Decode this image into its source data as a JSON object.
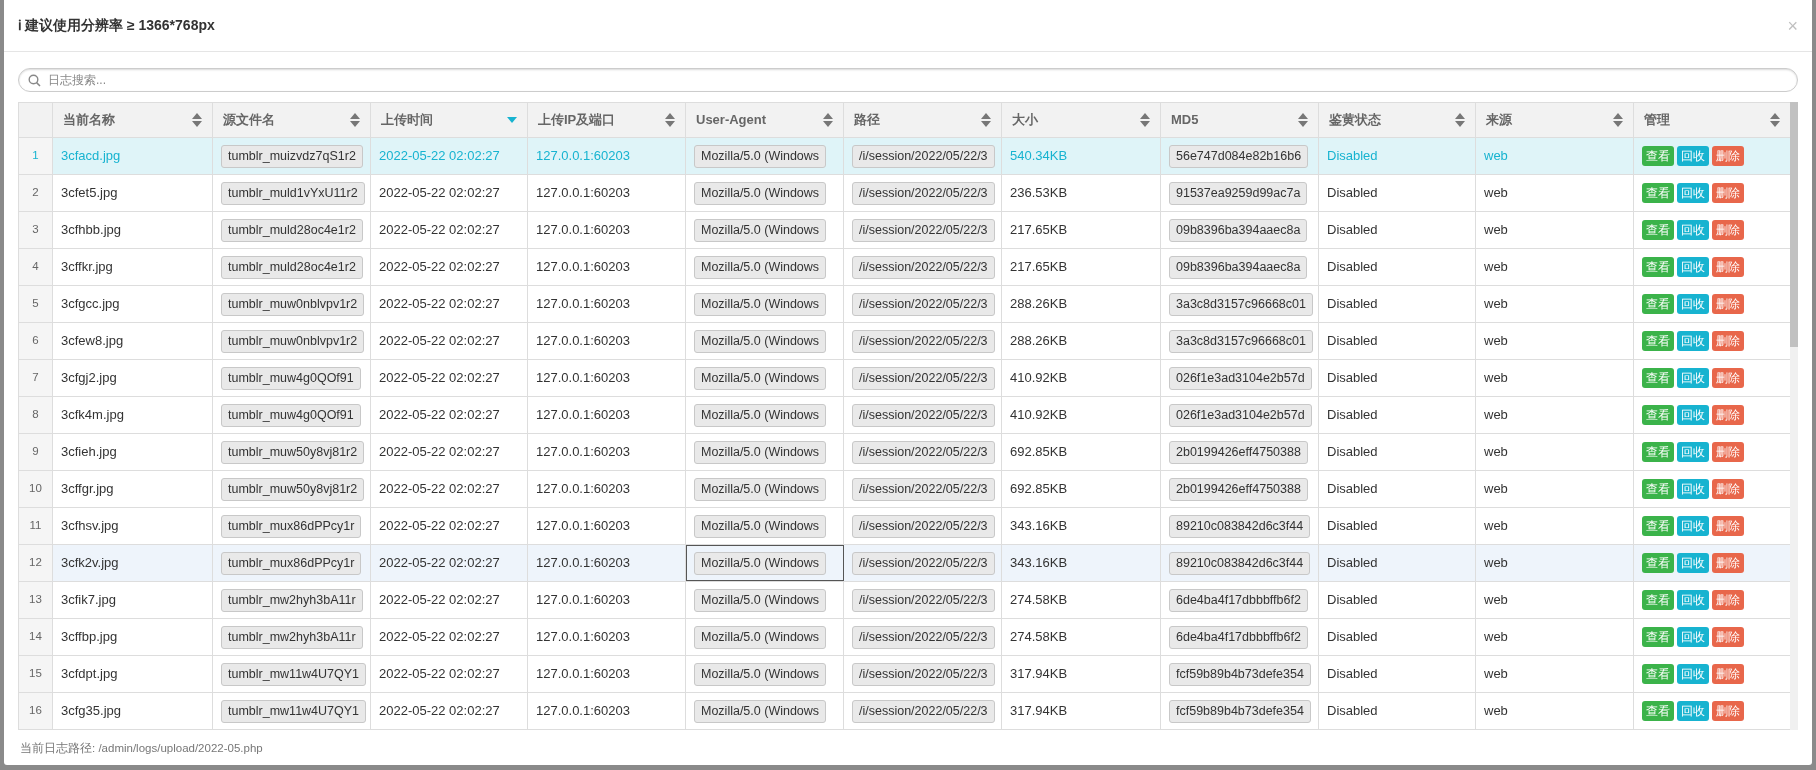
{
  "dialog": {
    "title": "建议使用分辨率 ≥ 1366*768px",
    "info_icon": "ℹ",
    "close": "×"
  },
  "search": {
    "placeholder": "日志搜索..."
  },
  "table": {
    "columns": [
      {
        "label": "当前名称",
        "sorted": false
      },
      {
        "label": "源文件名",
        "sorted": false
      },
      {
        "label": "上传时间",
        "sorted": true
      },
      {
        "label": "上传IP及端口",
        "sorted": false
      },
      {
        "label": "User-Agent",
        "sorted": false
      },
      {
        "label": "路径",
        "sorted": false
      },
      {
        "label": "大小",
        "sorted": false
      },
      {
        "label": "MD5",
        "sorted": false
      },
      {
        "label": "鉴黄状态",
        "sorted": false
      },
      {
        "label": "来源",
        "sorted": false
      },
      {
        "label": "管理",
        "sorted": false
      }
    ],
    "rows": [
      {
        "index": "1",
        "selected": true,
        "hovered": false,
        "name": "3cfacd.jpg",
        "source_file": "tumblr_muizvdz7qS1r2",
        "time": "2022-05-22 02:02:27",
        "ip": "127.0.0.1:60203",
        "user_agent": "Mozilla/5.0 (Windows",
        "path": "/i/session/2022/05/22/3",
        "size": "540.34KB",
        "md5": "56e747d084e82b16b6",
        "status": "Disabled",
        "origin": "web",
        "actions": [
          {
            "label": "查看",
            "kind": "view"
          },
          {
            "label": "回收",
            "kind": "recycle"
          },
          {
            "label": "删除",
            "kind": "delete"
          }
        ]
      },
      {
        "index": "2",
        "selected": false,
        "hovered": false,
        "name": "3cfet5.jpg",
        "source_file": "tumblr_muld1vYxU11r2",
        "time": "2022-05-22 02:02:27",
        "ip": "127.0.0.1:60203",
        "user_agent": "Mozilla/5.0 (Windows",
        "path": "/i/session/2022/05/22/3",
        "size": "236.53KB",
        "md5": "91537ea9259d99ac7a",
        "status": "Disabled",
        "origin": "web",
        "actions": [
          {
            "label": "查看",
            "kind": "view"
          },
          {
            "label": "回收",
            "kind": "recycle"
          },
          {
            "label": "删除",
            "kind": "delete"
          }
        ]
      },
      {
        "index": "3",
        "selected": false,
        "hovered": false,
        "name": "3cfhbb.jpg",
        "source_file": "tumblr_muld28oc4e1r2",
        "time": "2022-05-22 02:02:27",
        "ip": "127.0.0.1:60203",
        "user_agent": "Mozilla/5.0 (Windows",
        "path": "/i/session/2022/05/22/3",
        "size": "217.65KB",
        "md5": "09b8396ba394aaec8a",
        "status": "Disabled",
        "origin": "web",
        "actions": [
          {
            "label": "查看",
            "kind": "view"
          },
          {
            "label": "回收",
            "kind": "recycle"
          },
          {
            "label": "删除",
            "kind": "delete"
          }
        ]
      },
      {
        "index": "4",
        "selected": false,
        "hovered": false,
        "name": "3cffkr.jpg",
        "source_file": "tumblr_muld28oc4e1r2",
        "time": "2022-05-22 02:02:27",
        "ip": "127.0.0.1:60203",
        "user_agent": "Mozilla/5.0 (Windows",
        "path": "/i/session/2022/05/22/3",
        "size": "217.65KB",
        "md5": "09b8396ba394aaec8a",
        "status": "Disabled",
        "origin": "web",
        "actions": [
          {
            "label": "查看",
            "kind": "view"
          },
          {
            "label": "回收",
            "kind": "recycle"
          },
          {
            "label": "删除",
            "kind": "delete"
          }
        ]
      },
      {
        "index": "5",
        "selected": false,
        "hovered": false,
        "name": "3cfgcc.jpg",
        "source_file": "tumblr_muw0nblvpv1r2",
        "time": "2022-05-22 02:02:27",
        "ip": "127.0.0.1:60203",
        "user_agent": "Mozilla/5.0 (Windows",
        "path": "/i/session/2022/05/22/3",
        "size": "288.26KB",
        "md5": "3a3c8d3157c96668c01",
        "status": "Disabled",
        "origin": "web",
        "actions": [
          {
            "label": "查看",
            "kind": "view"
          },
          {
            "label": "回收",
            "kind": "recycle"
          },
          {
            "label": "删除",
            "kind": "delete"
          }
        ]
      },
      {
        "index": "6",
        "selected": false,
        "hovered": false,
        "name": "3cfew8.jpg",
        "source_file": "tumblr_muw0nblvpv1r2",
        "time": "2022-05-22 02:02:27",
        "ip": "127.0.0.1:60203",
        "user_agent": "Mozilla/5.0 (Windows",
        "path": "/i/session/2022/05/22/3",
        "size": "288.26KB",
        "md5": "3a3c8d3157c96668c01",
        "status": "Disabled",
        "origin": "web",
        "actions": [
          {
            "label": "查看",
            "kind": "view"
          },
          {
            "label": "回收",
            "kind": "recycle"
          },
          {
            "label": "删除",
            "kind": "delete"
          }
        ]
      },
      {
        "index": "7",
        "selected": false,
        "hovered": false,
        "name": "3cfgj2.jpg",
        "source_file": "tumblr_muw4g0QOf91",
        "time": "2022-05-22 02:02:27",
        "ip": "127.0.0.1:60203",
        "user_agent": "Mozilla/5.0 (Windows",
        "path": "/i/session/2022/05/22/3",
        "size": "410.92KB",
        "md5": "026f1e3ad3104e2b57d",
        "status": "Disabled",
        "origin": "web",
        "actions": [
          {
            "label": "查看",
            "kind": "view"
          },
          {
            "label": "回收",
            "kind": "recycle"
          },
          {
            "label": "删除",
            "kind": "delete"
          }
        ]
      },
      {
        "index": "8",
        "selected": false,
        "hovered": false,
        "name": "3cfk4m.jpg",
        "source_file": "tumblr_muw4g0QOf91",
        "time": "2022-05-22 02:02:27",
        "ip": "127.0.0.1:60203",
        "user_agent": "Mozilla/5.0 (Windows",
        "path": "/i/session/2022/05/22/3",
        "size": "410.92KB",
        "md5": "026f1e3ad3104e2b57d",
        "status": "Disabled",
        "origin": "web",
        "actions": [
          {
            "label": "查看",
            "kind": "view"
          },
          {
            "label": "回收",
            "kind": "recycle"
          },
          {
            "label": "删除",
            "kind": "delete"
          }
        ]
      },
      {
        "index": "9",
        "selected": false,
        "hovered": false,
        "name": "3cfieh.jpg",
        "source_file": "tumblr_muw50y8vj81r2",
        "time": "2022-05-22 02:02:27",
        "ip": "127.0.0.1:60203",
        "user_agent": "Mozilla/5.0 (Windows",
        "path": "/i/session/2022/05/22/3",
        "size": "692.85KB",
        "md5": "2b0199426eff4750388",
        "status": "Disabled",
        "origin": "web",
        "actions": [
          {
            "label": "查看",
            "kind": "view"
          },
          {
            "label": "回收",
            "kind": "recycle"
          },
          {
            "label": "删除",
            "kind": "delete"
          }
        ]
      },
      {
        "index": "10",
        "selected": false,
        "hovered": false,
        "name": "3cffgr.jpg",
        "source_file": "tumblr_muw50y8vj81r2",
        "time": "2022-05-22 02:02:27",
        "ip": "127.0.0.1:60203",
        "user_agent": "Mozilla/5.0 (Windows",
        "path": "/i/session/2022/05/22/3",
        "size": "692.85KB",
        "md5": "2b0199426eff4750388",
        "status": "Disabled",
        "origin": "web",
        "actions": [
          {
            "label": "查看",
            "kind": "view"
          },
          {
            "label": "回收",
            "kind": "recycle"
          },
          {
            "label": "删除",
            "kind": "delete"
          }
        ]
      },
      {
        "index": "11",
        "selected": false,
        "hovered": false,
        "name": "3cfhsv.jpg",
        "source_file": "tumblr_mux86dPPcy1r",
        "time": "2022-05-22 02:02:27",
        "ip": "127.0.0.1:60203",
        "user_agent": "Mozilla/5.0 (Windows",
        "path": "/i/session/2022/05/22/3",
        "size": "343.16KB",
        "md5": "89210c083842d6c3f44",
        "status": "Disabled",
        "origin": "web",
        "actions": [
          {
            "label": "查看",
            "kind": "view"
          },
          {
            "label": "回收",
            "kind": "recycle"
          },
          {
            "label": "删除",
            "kind": "delete"
          }
        ]
      },
      {
        "index": "12",
        "selected": false,
        "hovered": true,
        "name": "3cfk2v.jpg",
        "source_file": "tumblr_mux86dPPcy1r",
        "time": "2022-05-22 02:02:27",
        "ip": "127.0.0.1:60203",
        "user_agent": "Mozilla/5.0 (Windows",
        "path": "/i/session/2022/05/22/3",
        "size": "343.16KB",
        "md5": "89210c083842d6c3f44",
        "status": "Disabled",
        "origin": "web",
        "actions": [
          {
            "label": "查看",
            "kind": "view"
          },
          {
            "label": "回收",
            "kind": "recycle"
          },
          {
            "label": "删除",
            "kind": "delete"
          }
        ]
      },
      {
        "index": "13",
        "selected": false,
        "hovered": false,
        "name": "3cfik7.jpg",
        "source_file": "tumblr_mw2hyh3bA11r",
        "time": "2022-05-22 02:02:27",
        "ip": "127.0.0.1:60203",
        "user_agent": "Mozilla/5.0 (Windows",
        "path": "/i/session/2022/05/22/3",
        "size": "274.58KB",
        "md5": "6de4ba4f17dbbbffb6f2",
        "status": "Disabled",
        "origin": "web",
        "actions": [
          {
            "label": "查看",
            "kind": "view"
          },
          {
            "label": "回收",
            "kind": "recycle"
          },
          {
            "label": "删除",
            "kind": "delete"
          }
        ]
      },
      {
        "index": "14",
        "selected": false,
        "hovered": false,
        "name": "3cffbp.jpg",
        "source_file": "tumblr_mw2hyh3bA11r",
        "time": "2022-05-22 02:02:27",
        "ip": "127.0.0.1:60203",
        "user_agent": "Mozilla/5.0 (Windows",
        "path": "/i/session/2022/05/22/3",
        "size": "274.58KB",
        "md5": "6de4ba4f17dbbbffb6f2",
        "status": "Disabled",
        "origin": "web",
        "actions": [
          {
            "label": "查看",
            "kind": "view"
          },
          {
            "label": "回收",
            "kind": "recycle"
          },
          {
            "label": "删除",
            "kind": "delete"
          }
        ]
      },
      {
        "index": "15",
        "selected": false,
        "hovered": false,
        "name": "3cfdpt.jpg",
        "source_file": "tumblr_mw11w4U7QY1",
        "time": "2022-05-22 02:02:27",
        "ip": "127.0.0.1:60203",
        "user_agent": "Mozilla/5.0 (Windows",
        "path": "/i/session/2022/05/22/3",
        "size": "317.94KB",
        "md5": "fcf59b89b4b73defe354",
        "status": "Disabled",
        "origin": "web",
        "actions": [
          {
            "label": "查看",
            "kind": "view"
          },
          {
            "label": "回收",
            "kind": "recycle"
          },
          {
            "label": "删除",
            "kind": "delete"
          }
        ]
      },
      {
        "index": "16",
        "selected": false,
        "hovered": false,
        "name": "3cfg35.jpg",
        "source_file": "tumblr_mw11w4U7QY1",
        "time": "2022-05-22 02:02:27",
        "ip": "127.0.0.1:60203",
        "user_agent": "Mozilla/5.0 (Windows",
        "path": "/i/session/2022/05/22/3",
        "size": "317.94KB",
        "md5": "fcf59b89b4b73defe354",
        "status": "Disabled",
        "origin": "web",
        "actions": [
          {
            "label": "查看",
            "kind": "view"
          },
          {
            "label": "回收",
            "kind": "recycle"
          },
          {
            "label": "删除",
            "kind": "delete"
          }
        ]
      }
    ]
  },
  "footer": {
    "text": "当前日志路径: /admin/logs/upload/2022-05.php"
  }
}
